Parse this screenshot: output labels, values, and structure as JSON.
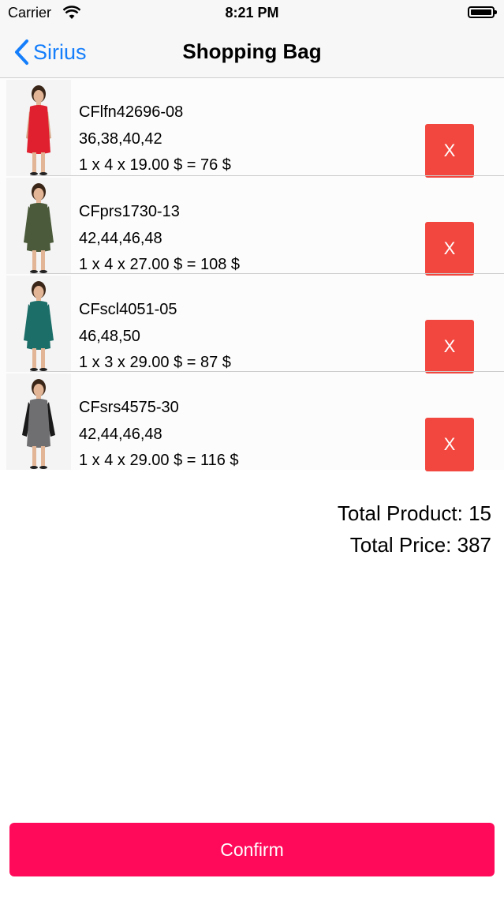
{
  "status_bar": {
    "carrier": "Carrier",
    "time": "8:21 PM"
  },
  "nav": {
    "back_label": "Sirius",
    "title": "Shopping Bag"
  },
  "bag": {
    "remove_label": "X",
    "items": [
      {
        "code": "CFlfn42696-08",
        "sizes": "36,38,40,42",
        "price_line": "1 x 4 x 19.00 $ = 76 $",
        "dress_color": "#e0202f",
        "sleeve": "none"
      },
      {
        "code": "CFprs1730-13",
        "sizes": "42,44,46,48",
        "price_line": "1 x 4 x 27.00 $ = 108 $",
        "dress_color": "#4a5a3a",
        "sleeve": "long"
      },
      {
        "code": "CFscl4051-05",
        "sizes": "46,48,50",
        "price_line": "1 x 3 x 29.00 $ = 87 $",
        "dress_color": "#1c6e68",
        "sleeve": "long"
      },
      {
        "code": "CFsrs4575-30",
        "sizes": "42,44,46,48",
        "price_line": "1 x 4 x 29.00 $ = 116 $",
        "dress_color": "#6f6f72",
        "sleeve": "black"
      }
    ]
  },
  "totals": {
    "total_product": "Total Product: 15",
    "total_price": "Total Price: 387"
  },
  "confirm": {
    "label": "Confirm"
  },
  "colors": {
    "accent": "#147efb",
    "remove": "#f2473f",
    "confirm": "#ff0a5a"
  }
}
